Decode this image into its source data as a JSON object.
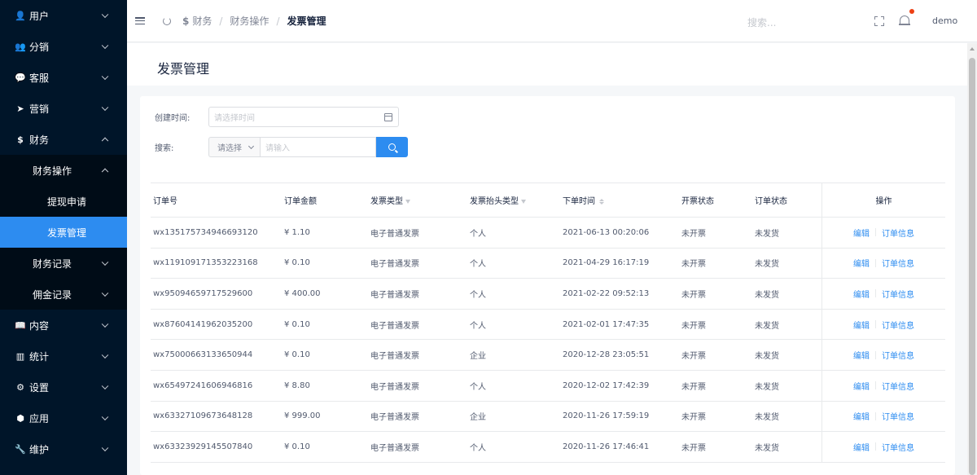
{
  "sidebar": {
    "items": [
      {
        "label": "用户",
        "icon": "user-icon",
        "glyph": "👤"
      },
      {
        "label": "分销",
        "icon": "group-icon",
        "glyph": "👥"
      },
      {
        "label": "客服",
        "icon": "chat-icon",
        "glyph": "💬"
      },
      {
        "label": "营销",
        "icon": "send-icon",
        "glyph": "➤"
      },
      {
        "label": "财务",
        "icon": "dollar-icon",
        "glyph": "$"
      },
      {
        "label": "内容",
        "icon": "book-icon",
        "glyph": "📖"
      },
      {
        "label": "统计",
        "icon": "bar-chart-icon",
        "glyph": "▥"
      },
      {
        "label": "设置",
        "icon": "gear-icon",
        "glyph": "⚙"
      },
      {
        "label": "应用",
        "icon": "cube-icon",
        "glyph": "⬢"
      },
      {
        "label": "维护",
        "icon": "wrench-icon",
        "glyph": "🔧"
      }
    ],
    "finance_sub": [
      {
        "label": "财务操作"
      },
      {
        "label": "财务记录"
      },
      {
        "label": "佣金记录"
      }
    ],
    "finance_ops_sub": [
      {
        "label": "提现申请"
      },
      {
        "label": "发票管理"
      }
    ]
  },
  "header": {
    "breadcrumb": [
      "财务",
      "财务操作",
      "发票管理"
    ],
    "separator": "/",
    "search_placeholder": "搜索...",
    "username": "demo"
  },
  "page": {
    "title": "发票管理"
  },
  "filters": {
    "created_label": "创建时间:",
    "created_placeholder": "请选择时间",
    "search_label": "搜索:",
    "select_placeholder": "请选择",
    "input_placeholder": "请输入"
  },
  "table": {
    "columns": [
      "订单号",
      "订单金额",
      "发票类型",
      "发票抬头类型",
      "下单时间",
      "开票状态",
      "订单状态",
      "操作"
    ],
    "actions": {
      "edit": "编辑",
      "order_info": "订单信息"
    },
    "rows": [
      {
        "order_no": "wx135175734946693120",
        "amount": "¥ 1.10",
        "invoice_type": "电子普通发票",
        "title_type": "个人",
        "time": "2021-06-13 00:20:06",
        "invoice_status": "未开票",
        "order_status": "未发货"
      },
      {
        "order_no": "wx119109171353223168",
        "amount": "¥ 0.10",
        "invoice_type": "电子普通发票",
        "title_type": "个人",
        "time": "2021-04-29 16:17:19",
        "invoice_status": "未开票",
        "order_status": "未发货"
      },
      {
        "order_no": "wx95094659717529600",
        "amount": "¥ 400.00",
        "invoice_type": "电子普通发票",
        "title_type": "个人",
        "time": "2021-02-22 09:52:13",
        "invoice_status": "未开票",
        "order_status": "未发货"
      },
      {
        "order_no": "wx87604141962035200",
        "amount": "¥ 0.10",
        "invoice_type": "电子普通发票",
        "title_type": "个人",
        "time": "2021-02-01 17:47:35",
        "invoice_status": "未开票",
        "order_status": "未发货"
      },
      {
        "order_no": "wx75000663133650944",
        "amount": "¥ 0.10",
        "invoice_type": "电子普通发票",
        "title_type": "企业",
        "time": "2020-12-28 23:05:51",
        "invoice_status": "未开票",
        "order_status": "未发货"
      },
      {
        "order_no": "wx65497241606946816",
        "amount": "¥ 8.80",
        "invoice_type": "电子普通发票",
        "title_type": "个人",
        "time": "2020-12-02 17:42:39",
        "invoice_status": "未开票",
        "order_status": "未发货"
      },
      {
        "order_no": "wx63327109673648128",
        "amount": "¥ 999.00",
        "invoice_type": "电子普通发票",
        "title_type": "企业",
        "time": "2020-11-26 17:59:19",
        "invoice_status": "未开票",
        "order_status": "未发货"
      },
      {
        "order_no": "wx63323929145507840",
        "amount": "¥ 0.10",
        "invoice_type": "电子普通发票",
        "title_type": "个人",
        "time": "2020-11-26 17:46:41",
        "invoice_status": "未开票",
        "order_status": "未发货"
      }
    ]
  },
  "colors": {
    "sidebar_bg": "#001529",
    "submenu_bg": "#000c17",
    "accent": "#2d8cf0",
    "notification_dot": "#ed4014"
  }
}
